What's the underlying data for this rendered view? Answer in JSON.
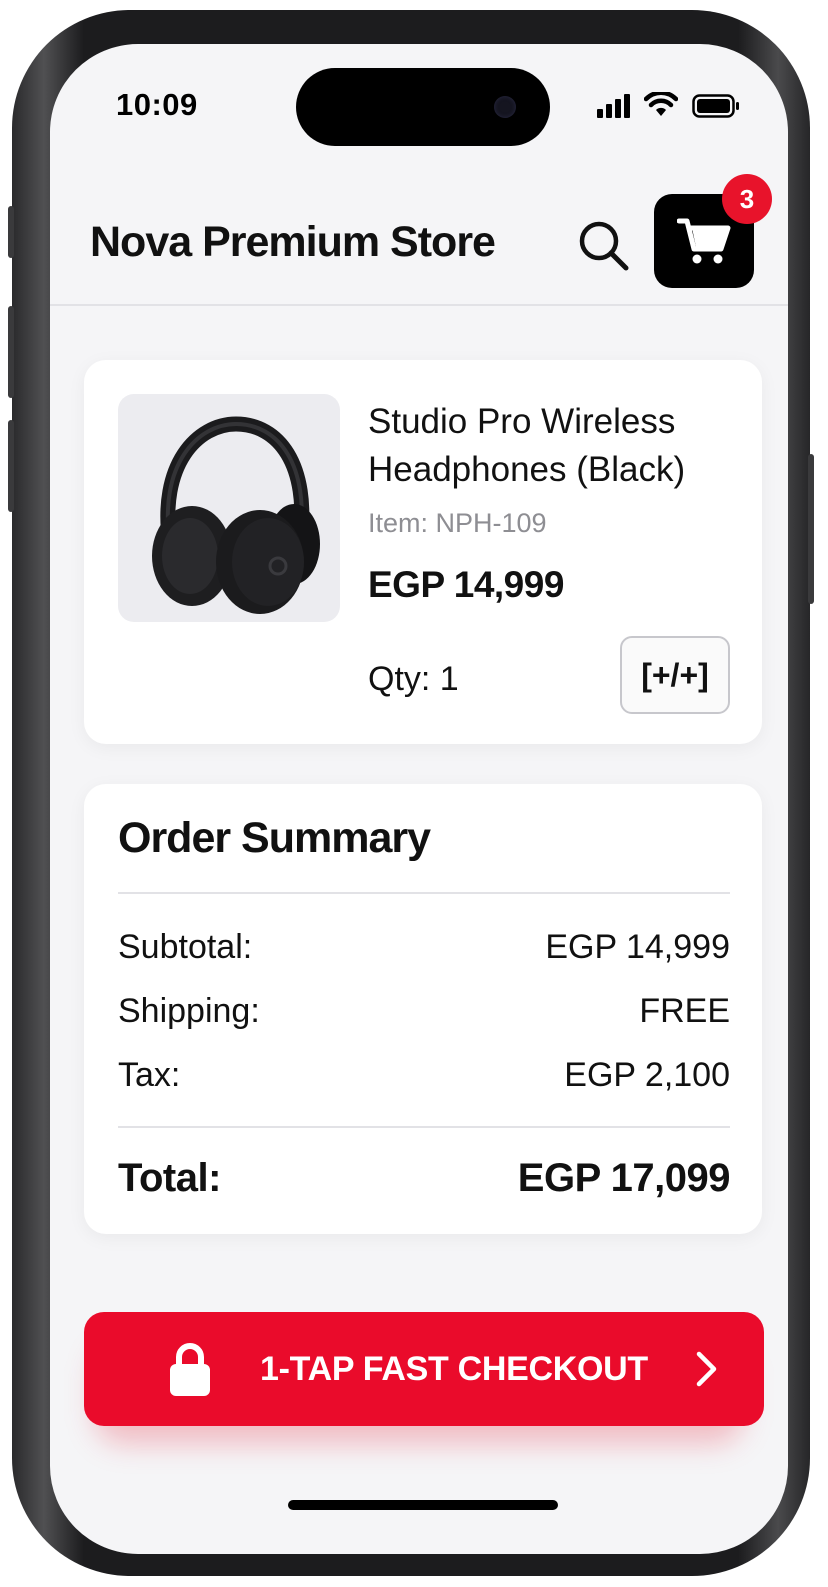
{
  "status_bar": {
    "time": "10:09"
  },
  "header": {
    "store_title": "Nova Premium Store",
    "cart_count": "3"
  },
  "product": {
    "name_line1": "Studio Pro Wireless",
    "name_line2": "Headphones (Black)",
    "sku": "Item: NPH-109",
    "price": "EGP 14,999",
    "qty": "Qty: 1",
    "qty_control_label": "[+/+]"
  },
  "summary": {
    "title": "Order Summary",
    "rows": [
      {
        "label": "Subtotal:",
        "value": "EGP 14,999"
      },
      {
        "label": "Shipping:",
        "value": "FREE"
      },
      {
        "label": "Tax:",
        "value": "EGP 2,100"
      }
    ],
    "total_label": "Total:",
    "total_value": "EGP 17,099"
  },
  "checkout": {
    "label": "1-TAP FAST CHECKOUT"
  },
  "icons": {
    "search": "search-icon",
    "cart": "shopping-cart-icon",
    "lock": "lock-icon",
    "chevron": "chevron-right-icon"
  },
  "colors": {
    "accent": "#ea0b2b",
    "badge": "#e8132b",
    "screen_bg": "#f5f5f7"
  }
}
